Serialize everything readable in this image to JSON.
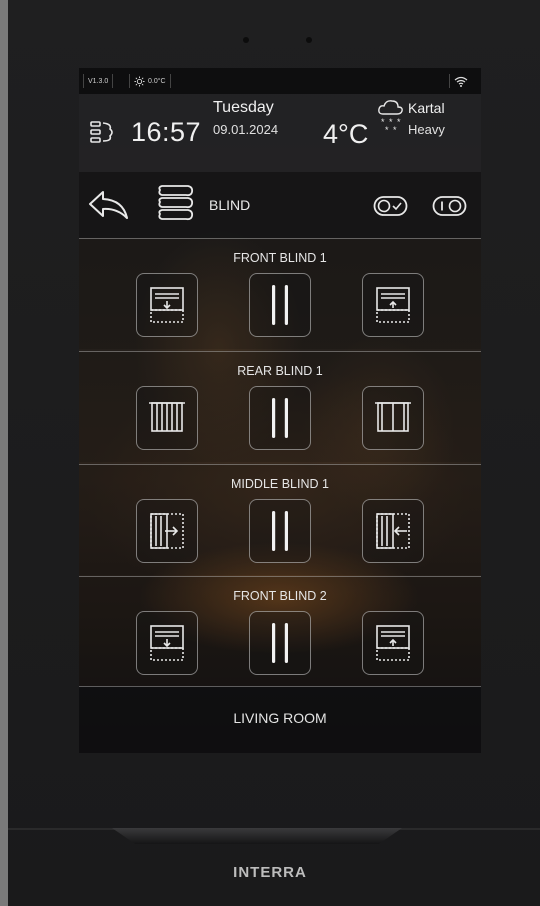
{
  "status_bar": {
    "version": "V1.3.0",
    "indoor_temp": "0.0°C",
    "wifi_icon": "wifi-icon"
  },
  "header": {
    "time": "16:57",
    "day": "Tuesday",
    "date": "09.01.2024",
    "temperature": "4°C",
    "city": "Kartal",
    "weather": "Heavy"
  },
  "toolbar": {
    "title": "BLIND"
  },
  "sections": [
    {
      "title": "FRONT BLIND 1",
      "left_icon": "blind-down-icon",
      "middle_icon": "pause-icon",
      "right_icon": "blind-up-icon"
    },
    {
      "title": "REAR BLIND 1",
      "left_icon": "vertical-blind-close-icon",
      "middle_icon": "pause-icon",
      "right_icon": "vertical-blind-open-icon"
    },
    {
      "title": "MIDDLE BLIND 1",
      "left_icon": "blind-slide-right-icon",
      "middle_icon": "pause-icon",
      "right_icon": "blind-slide-left-icon"
    },
    {
      "title": "FRONT BLIND 2",
      "left_icon": "blind-down-icon",
      "middle_icon": "pause-icon",
      "right_icon": "blind-up-icon"
    }
  ],
  "footer": {
    "room": "LIVING ROOM"
  },
  "brand": "INTERRA"
}
